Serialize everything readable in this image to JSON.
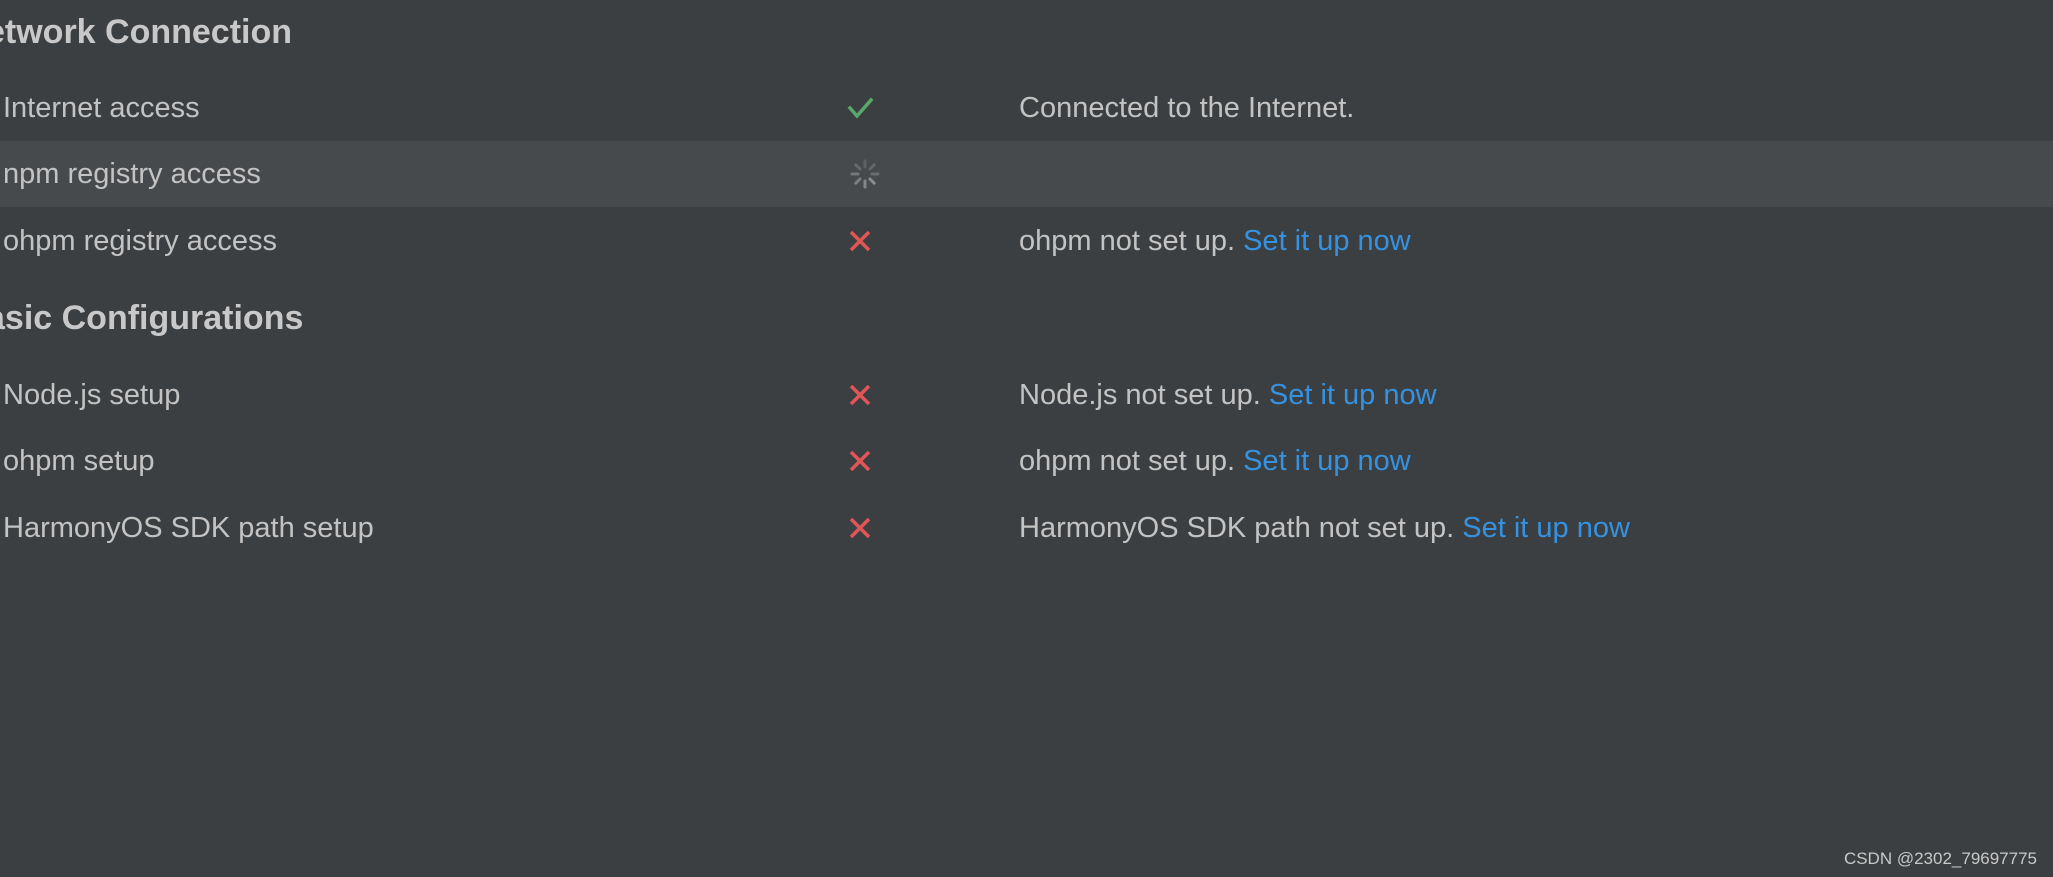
{
  "network": {
    "title": "etwork Connection",
    "rows": [
      {
        "label": "Internet access",
        "status_icon": "check-icon",
        "message": "Connected to the Internet.",
        "link": ""
      },
      {
        "label": "npm registry access",
        "status_icon": "loading-spinner-icon",
        "message": "",
        "link": ""
      },
      {
        "label": "ohpm registry access",
        "status_icon": "cross-icon",
        "message": "ohpm not set up. ",
        "link": "Set it up now"
      }
    ]
  },
  "basic": {
    "title": "asic Configurations",
    "rows": [
      {
        "label": "Node.js setup",
        "status_icon": "cross-icon",
        "message": "Node.js not set up. ",
        "link": "Set it up now"
      },
      {
        "label": "ohpm setup",
        "status_icon": "cross-icon",
        "message": "ohpm not set up. ",
        "link": "Set it up now"
      },
      {
        "label": "HarmonyOS SDK path setup",
        "status_icon": "cross-icon",
        "message": "HarmonyOS SDK path not set up. ",
        "link": "Set it up now"
      }
    ]
  },
  "colors": {
    "background": "#3c3f41",
    "highlight_row": "#474a4d",
    "success": "#59a869",
    "error": "#e05555",
    "link": "#3592e0",
    "spinner": "#8c8c8c"
  },
  "watermark": "CSDN @2302_79697775"
}
